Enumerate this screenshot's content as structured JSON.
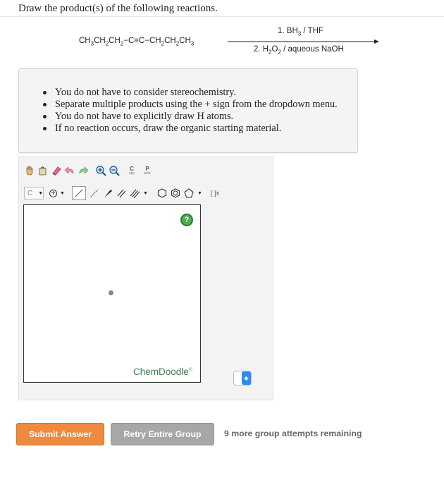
{
  "question": "Draw the product(s) of the following reactions.",
  "reaction": {
    "reactant": {
      "p1": "CH",
      "s1": "3",
      "p2": "CH",
      "s2": "2",
      "p3": "CH",
      "s3": "2",
      "p4": "−C≡C−CH",
      "s4": "2",
      "p5": "CH",
      "s5": "2",
      "p6": "CH",
      "s6": "3"
    },
    "condition1": {
      "pre": "1. BH",
      "sub": "3",
      "post": " / THF"
    },
    "condition2": {
      "pre": "2. H",
      "sub1": "2",
      "mid": "O",
      "sub2": "2",
      "post": " / aqueous NaOH"
    }
  },
  "notes": [
    "You do not have to consider stereochemistry.",
    "Separate multiple products using the + sign from the dropdown menu.",
    "You do not have to explicitly draw H atoms.",
    "If no reaction occurs, draw the organic starting material."
  ],
  "toolbar": {
    "copy_top": "C",
    "copy_bottom": "opy",
    "paste_top": "P",
    "paste_bottom": "aste",
    "atom_label": "C",
    "charges_label": "[ ]±"
  },
  "canvas": {
    "help_label": "?",
    "brand": "ChemDoodle",
    "brand_mark": "®"
  },
  "actions": {
    "submit": "Submit Answer",
    "retry": "Retry Entire Group",
    "remaining": "9 more group attempts remaining"
  },
  "colors": {
    "submit": "#ef8a3f",
    "retry": "#a7a7a7",
    "brand": "#3e7d54",
    "select_accent": "#2d8cf0"
  }
}
